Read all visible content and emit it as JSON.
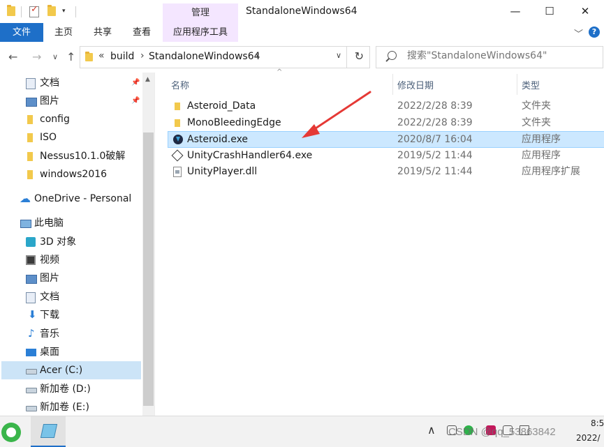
{
  "window": {
    "title": "StandaloneWindows64",
    "context_tab_header": "管理",
    "controls": {
      "minimize": "—",
      "maximize": "☐",
      "close": "✕"
    }
  },
  "ribbon": {
    "tabs": [
      "文件",
      "主页",
      "共享",
      "查看",
      "应用程序工具"
    ],
    "expand_glyph": "﹀",
    "help_glyph": "?",
    "accent_color": "#1e6fc8",
    "context_tab_color": "#f4e6ff"
  },
  "nav": {
    "back": "←",
    "forward": "→",
    "dropdown": "∨",
    "up": "↑",
    "breadcrumb_overflow": "«",
    "breadcrumb": [
      "build",
      "StandaloneWindows64"
    ],
    "breadcrumb_sep": "›",
    "address_dropdown": "∨",
    "refresh": "↻",
    "search_placeholder": "搜索\"StandaloneWindows64\""
  },
  "sidebar": {
    "scroll_up": "▲",
    "pin_glyph": "📌",
    "items": [
      {
        "label": "文档",
        "icon": "document-icon",
        "pinned": true
      },
      {
        "label": "图片",
        "icon": "picture-icon",
        "pinned": true
      },
      {
        "label": "config",
        "icon": "folder-icon"
      },
      {
        "label": "ISO",
        "icon": "folder-icon"
      },
      {
        "label": "Nessus10.1.0破解",
        "icon": "folder-icon"
      },
      {
        "label": "windows2016",
        "icon": "folder-icon"
      },
      {
        "label": "OneDrive - Personal",
        "icon": "onedrive-icon"
      },
      {
        "label": "此电脑",
        "icon": "this-pc-icon"
      },
      {
        "label": "3D 对象",
        "icon": "3d-objects-icon"
      },
      {
        "label": "视频",
        "icon": "video-icon"
      },
      {
        "label": "图片",
        "icon": "picture-icon"
      },
      {
        "label": "文档",
        "icon": "document-icon"
      },
      {
        "label": "下载",
        "icon": "download-icon"
      },
      {
        "label": "音乐",
        "icon": "music-icon"
      },
      {
        "label": "桌面",
        "icon": "desktop-icon"
      },
      {
        "label": "Acer (C:)",
        "icon": "drive-icon",
        "selected": true
      },
      {
        "label": "新加卷 (D:)",
        "icon": "drive-icon"
      },
      {
        "label": "新加卷 (E:)",
        "icon": "drive-icon"
      }
    ]
  },
  "files": {
    "sort_glyph": "^",
    "columns": {
      "name": "名称",
      "date": "修改日期",
      "type": "类型"
    },
    "rows": [
      {
        "name": "Asteroid_Data",
        "date": "2022/2/28 8:39",
        "type": "文件夹",
        "icon": "folder-icon"
      },
      {
        "name": "MonoBleedingEdge",
        "date": "2022/2/28 8:39",
        "type": "文件夹",
        "icon": "folder-icon"
      },
      {
        "name": "Asteroid.exe",
        "date": "2020/8/7 16:04",
        "type": "应用程序",
        "icon": "app-icon",
        "selected": true
      },
      {
        "name": "UnityCrashHandler64.exe",
        "date": "2019/5/2 11:44",
        "type": "应用程序",
        "icon": "unity-icon"
      },
      {
        "name": "UnityPlayer.dll",
        "date": "2019/5/2 11:44",
        "type": "应用程序扩展",
        "icon": "dll-icon"
      }
    ],
    "selection_color": "#cce8ff",
    "annotation_color": "#e53935"
  },
  "taskbar": {
    "tray_chevron": "∧",
    "time": "8:5",
    "date": "2022/",
    "watermark": "CSDN @qq_53863842"
  }
}
